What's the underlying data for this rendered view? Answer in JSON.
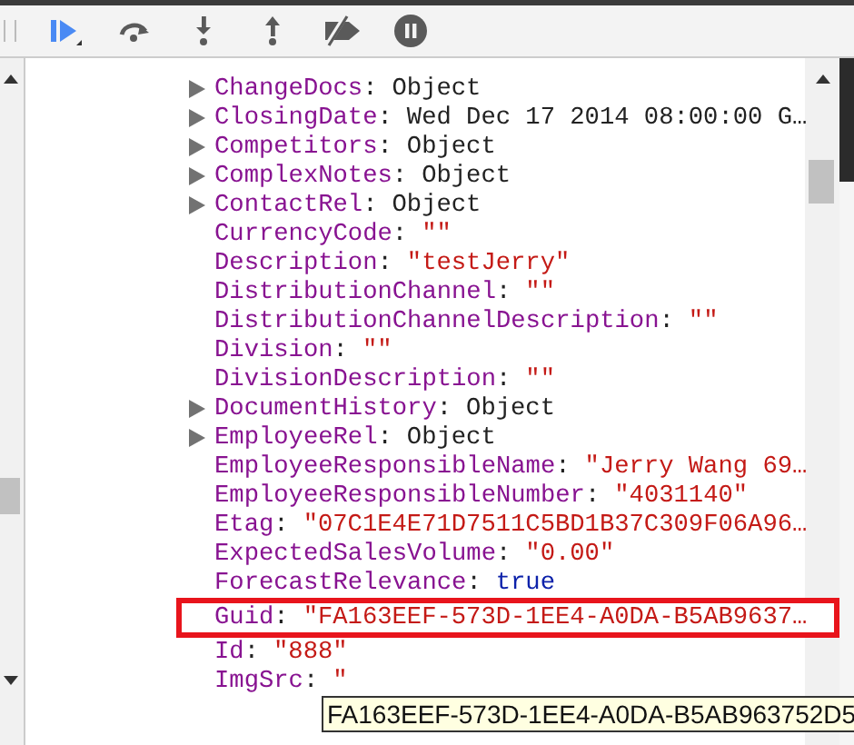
{
  "toolbar": {
    "buttons": [
      {
        "kind": "resume"
      },
      {
        "kind": "step-over"
      },
      {
        "kind": "step-into"
      },
      {
        "kind": "step-out"
      },
      {
        "kind": "deactivate"
      },
      {
        "kind": "pause"
      }
    ]
  },
  "properties": [
    {
      "key": "ChangeDocs",
      "separator": ":",
      "value": "Object",
      "kind": "object",
      "expandable": true,
      "highlighted": false
    },
    {
      "key": "ClosingDate",
      "separator": ":",
      "value": "Wed Dec 17 2014 08:00:00 G…",
      "kind": "object",
      "expandable": true,
      "highlighted": false
    },
    {
      "key": "Competitors",
      "separator": ":",
      "value": "Object",
      "kind": "object",
      "expandable": true,
      "highlighted": false
    },
    {
      "key": "ComplexNotes",
      "separator": ":",
      "value": "Object",
      "kind": "object",
      "expandable": true,
      "highlighted": false
    },
    {
      "key": "ContactRel",
      "separator": ":",
      "value": "Object",
      "kind": "object",
      "expandable": true,
      "highlighted": false
    },
    {
      "key": "CurrencyCode",
      "separator": ":",
      "value": "\"\"",
      "kind": "string",
      "expandable": false,
      "highlighted": false
    },
    {
      "key": "Description",
      "separator": ":",
      "value": "\"testJerry\"",
      "kind": "string",
      "expandable": false,
      "highlighted": false
    },
    {
      "key": "DistributionChannel",
      "separator": ":",
      "value": "\"\"",
      "kind": "string",
      "expandable": false,
      "highlighted": false
    },
    {
      "key": "DistributionChannelDescription",
      "separator": ":",
      "value": "\"\"",
      "kind": "string",
      "expandable": false,
      "highlighted": false
    },
    {
      "key": "Division",
      "separator": ":",
      "value": "\"\"",
      "kind": "string",
      "expandable": false,
      "highlighted": false
    },
    {
      "key": "DivisionDescription",
      "separator": ":",
      "value": "\"\"",
      "kind": "string",
      "expandable": false,
      "highlighted": false
    },
    {
      "key": "DocumentHistory",
      "separator": ":",
      "value": "Object",
      "kind": "object",
      "expandable": true,
      "highlighted": false
    },
    {
      "key": "EmployeeRel",
      "separator": ":",
      "value": "Object",
      "kind": "object",
      "expandable": true,
      "highlighted": false
    },
    {
      "key": "EmployeeResponsibleName",
      "separator": ":",
      "value": "\"Jerry Wang 69…",
      "kind": "string",
      "expandable": false,
      "highlighted": false
    },
    {
      "key": "EmployeeResponsibleNumber",
      "separator": ":",
      "value": "\"4031140\"",
      "kind": "string",
      "expandable": false,
      "highlighted": false
    },
    {
      "key": "Etag",
      "separator": ":",
      "value": "\"07C1E4E71D7511C5BD1B37C309F06A96…",
      "kind": "string",
      "expandable": false,
      "highlighted": false
    },
    {
      "key": "ExpectedSalesVolume",
      "separator": ":",
      "value": "\"0.00\"",
      "kind": "string",
      "expandable": false,
      "highlighted": false
    },
    {
      "key": "ForecastRelevance",
      "separator": ":",
      "value": "true",
      "kind": "boolean",
      "expandable": false,
      "highlighted": false
    },
    {
      "key": "Guid",
      "separator": ":",
      "value": "\"FA163EEF-573D-1EE4-A0DA-B5AB9637…",
      "kind": "string",
      "expandable": false,
      "highlighted": true
    },
    {
      "key": "Id",
      "separator": ":",
      "value": "\"888\"",
      "kind": "string",
      "expandable": false,
      "highlighted": false
    },
    {
      "key": "ImgSrc",
      "separator": ":",
      "value": "\"",
      "kind": "string",
      "expandable": false,
      "highlighted": false
    }
  ],
  "tooltip": {
    "text": "FA163EEF-573D-1EE4-A0DA-B5AB963752D5"
  }
}
